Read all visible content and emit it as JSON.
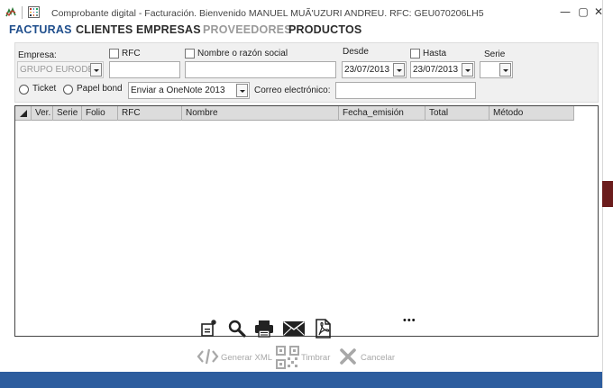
{
  "window": {
    "title": "Comprobante digital - Facturación. Bienvenido MANUEL MUÃ'UZURI ANDREU. RFC: GEU070206LH5",
    "controls": [
      "—",
      "▢",
      "✕"
    ]
  },
  "menu": {
    "items": [
      "FACTURAS",
      "CLIENTES",
      "EMPRESAS",
      "PROVEEDORES",
      "PRODUCTOS"
    ],
    "active_color": "#1f4e8c",
    "inactive_color": "#2b2b2b",
    "disabled_color": "#9a9a9a"
  },
  "filters": {
    "empresa_label": "Empresa:",
    "empresa_value": "GRUPO EURODESI",
    "rfc_label": "RFC",
    "rfc_value": "",
    "nombre_label": "Nombre o razón social",
    "nombre_value": "",
    "desde_label": "Desde",
    "desde_value": "23/07/2013",
    "hasta_label": "Hasta",
    "hasta_value": "23/07/2013",
    "serie_label": "Serie",
    "serie_value": "",
    "ticket_label": "Ticket",
    "papel_label": "Papel bond",
    "enviar_value": "Enviar a OneNote 2013",
    "correo_label": "Correo electrónico:",
    "correo_value": ""
  },
  "grid": {
    "columns": [
      "Ver.",
      "Serie",
      "Folio",
      "RFC",
      "Nombre",
      "Fecha_emisión",
      "Total",
      "Método"
    ],
    "rows": []
  },
  "toolbar": {
    "icons": [
      "new-document-icon",
      "search-icon",
      "print-icon",
      "email-icon",
      "pdf-icon",
      "more-icon"
    ],
    "more_label": "•••"
  },
  "actions": {
    "generar_xml": "Generar XML",
    "timbrar": "Timbrar",
    "cancelar": "Cancelar"
  },
  "colors": {
    "bottom_bar": "#2d5d9e",
    "accent_tab": "#6b1c1c"
  }
}
